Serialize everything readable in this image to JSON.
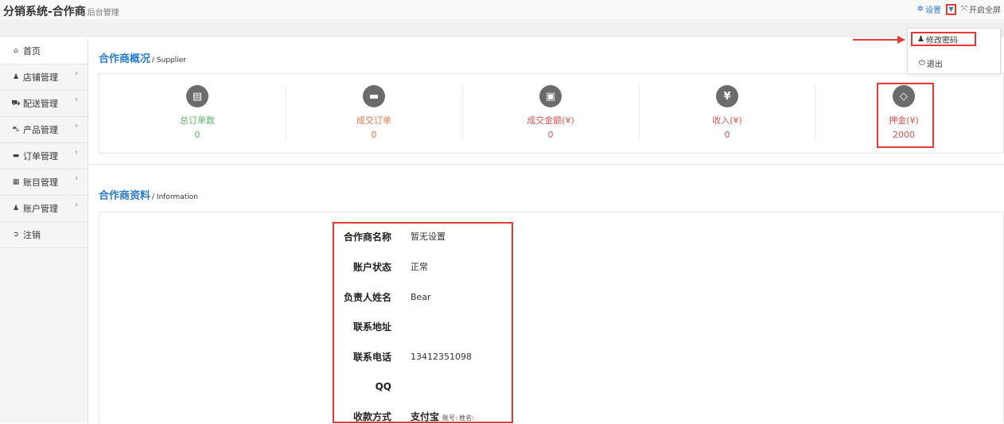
{
  "header": {
    "brand_title": "分销系统-合作商",
    "brand_sub": "后台管理",
    "settings_label": "设置",
    "fullscreen_label": "开启全屏"
  },
  "dropdown": {
    "change_password": "修改密码",
    "logout": "退出"
  },
  "sidebar": {
    "items": [
      {
        "label": "首页",
        "icon": "home-icon"
      },
      {
        "label": "店铺管理",
        "icon": "user-icon"
      },
      {
        "label": "配送管理",
        "icon": "truck-icon"
      },
      {
        "label": "产品管理",
        "icon": "cart-icon"
      },
      {
        "label": "订单管理",
        "icon": "briefcase-icon"
      },
      {
        "label": "账目管理",
        "icon": "table-icon"
      },
      {
        "label": "账户管理",
        "icon": "user-icon"
      },
      {
        "label": "注销",
        "icon": "sign-out-icon"
      }
    ]
  },
  "overview": {
    "title": "合作商概况",
    "subtitle": "/ Supplier",
    "stats": [
      {
        "label": "总订单数",
        "value": "0",
        "icon": "file-icon",
        "color": "#5fb36b"
      },
      {
        "label": "成交订单",
        "value": "0",
        "icon": "briefcase-icon",
        "color": "#e0784d"
      },
      {
        "label": "成交金额(¥)",
        "value": "0",
        "icon": "money-icon",
        "color": "#d9534f"
      },
      {
        "label": "收入(¥)",
        "value": "0",
        "icon": "yen-icon",
        "color": "#d9534f"
      },
      {
        "label": "押金(¥)",
        "value": "2000",
        "icon": "diamond-icon",
        "color": "#d9534f"
      }
    ]
  },
  "info": {
    "title": "合作商资料",
    "subtitle": "/ Information",
    "rows": [
      {
        "key": "合作商名称",
        "value": "暂无设置"
      },
      {
        "key": "账户状态",
        "value": "正常"
      },
      {
        "key": "负责人姓名",
        "value": "Bear"
      },
      {
        "key": "联系地址",
        "value": ""
      },
      {
        "key": "联系电话",
        "value": "13412351098"
      },
      {
        "key": "QQ",
        "value": ""
      },
      {
        "key": "收款方式",
        "value": "支付宝",
        "extra": "账号:  姓名:"
      }
    ]
  }
}
